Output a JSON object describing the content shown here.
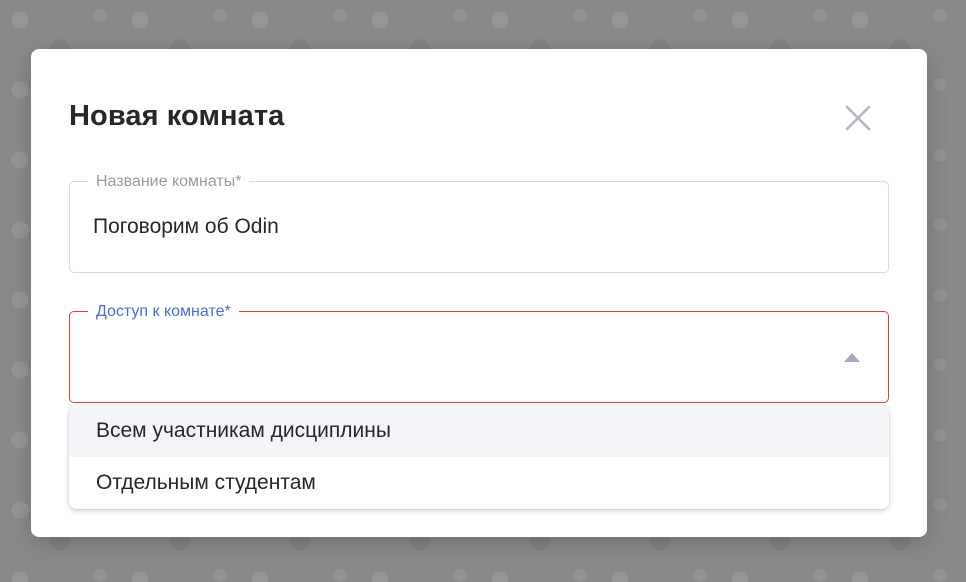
{
  "modal": {
    "title": "Новая комната",
    "close_icon": "close-icon"
  },
  "room_name_field": {
    "label": "Название комнаты*",
    "value": "Поговорим об Odin"
  },
  "access_field": {
    "label": "Доступ к комнате*",
    "value": "",
    "arrow_icon": "caret-up-icon",
    "options": [
      {
        "label": "Всем участникам дисциплины",
        "highlighted": true
      },
      {
        "label": "Отдельным студентам",
        "highlighted": false
      }
    ]
  },
  "colors": {
    "backdrop": "#858585",
    "title_text": "#26262b",
    "error_border": "#c8473d",
    "focus_label": "#4a6cdb",
    "muted_label": "#9a9aa3",
    "close_icon": "#b3b7cc",
    "option_highlight": "#f4f5f8"
  }
}
